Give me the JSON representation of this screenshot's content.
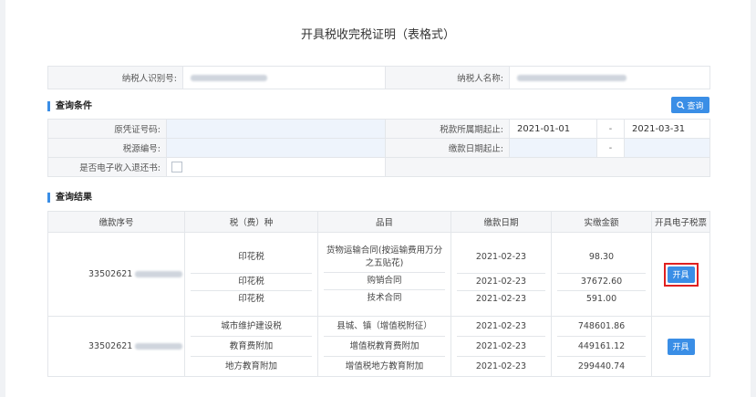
{
  "title": "开具税收完税证明（表格式）",
  "taxpayer": {
    "id_label": "纳税人识别号:",
    "name_label": "纳税人名称:"
  },
  "conditions": {
    "section": "查询条件",
    "query_button": "查询",
    "original_cert_label": "原凭证号码:",
    "tax_period_label": "税款所属期起止:",
    "period_start": "2021-01-01",
    "period_sep": "-",
    "period_end": "2021-03-31",
    "tax_source_label": "税源编号:",
    "payment_date_label": "缴款日期起止:",
    "date_sep": "-",
    "refund_label": "是否电子收入退还书:"
  },
  "results": {
    "section": "查询结果",
    "headers": [
      "缴款序号",
      "税（费）种",
      "品目",
      "缴款日期",
      "实缴金额",
      "开具电子税票"
    ],
    "open_button": "开具",
    "rows": [
      {
        "serial": "33502621",
        "taxes": [
          "印花税",
          "印花税",
          "印花税"
        ],
        "items": [
          "货物运输合同(按运输费用万分之五贴花)",
          "购销合同",
          "技术合同"
        ],
        "dates": [
          "2021-02-23",
          "2021-02-23",
          "2021-02-23"
        ],
        "amounts": [
          "98.30",
          "37672.60",
          "591.00"
        ]
      },
      {
        "serial": "33502621",
        "taxes": [
          "城市维护建设税",
          "教育费附加",
          "地方教育附加"
        ],
        "items": [
          "县城、镇（增值税附征）",
          "增值税教育费附加",
          "增值税地方教育附加"
        ],
        "dates": [
          "2021-02-23",
          "2021-02-23",
          "2021-02-23"
        ],
        "amounts": [
          "748601.86",
          "449161.12",
          "299440.74"
        ]
      }
    ]
  }
}
